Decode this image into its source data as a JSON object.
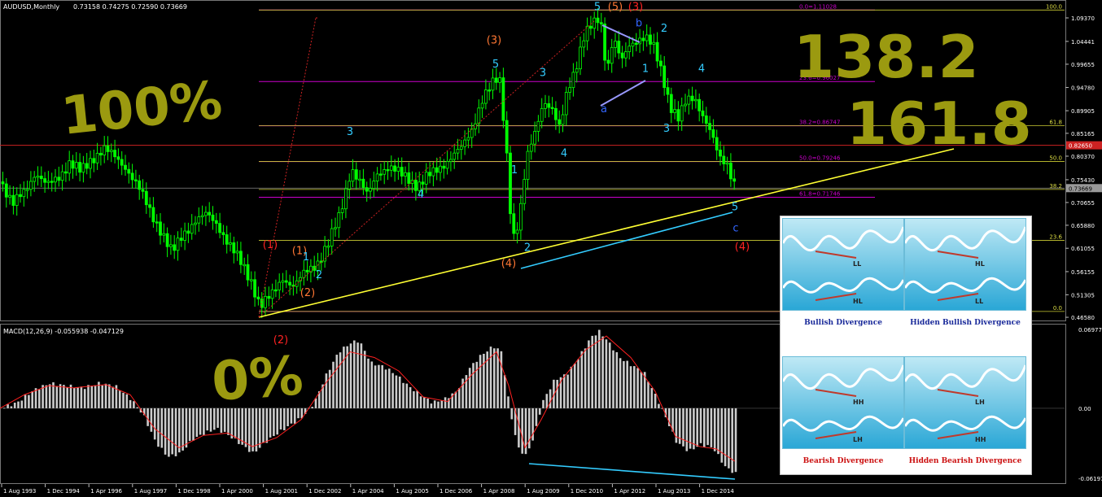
{
  "window": {
    "symbol_header": "AUDUSD,Monthly",
    "ohlc": "0.73158 0.74275 0.72590 0.73669",
    "macd_header": "MACD(12,26,9) -0.055938 -0.047129"
  },
  "colors": {
    "background": "#000000",
    "candle": "#00ff00",
    "fib": "#cc00cc",
    "trend": "#ffff33",
    "cyan": "#33ccff",
    "orange_label": "#ff7733",
    "red_label": "#ff2222",
    "blue_label": "#3366ff",
    "handwriting": "#9b9a10",
    "macd_hist": "#cccccc",
    "macd_signal": "#ff2020"
  },
  "annotations": {
    "big_100": "100%",
    "big_0": "0%",
    "big_138": "138.2",
    "big_161": "161.8"
  },
  "chart_data": [
    {
      "type": "candlestick",
      "title": "AUDUSD,Monthly",
      "ylim": [
        0.4659,
        1.1176
      ],
      "x_ticks": [
        "1 Aug 1993",
        "1 Dec 1994",
        "1 Apr 1996",
        "1 Aug 1997",
        "1 Dec 1998",
        "1 Apr 2000",
        "1 Aug 2001",
        "1 Dec 2002",
        "1 Apr 2004",
        "1 Aug 2005",
        "1 Dec 2006",
        "1 Apr 2008",
        "1 Aug 2009",
        "1 Dec 2010",
        "1 Apr 2012",
        "1 Aug 2013",
        "1 Dec 2014"
      ],
      "y_ticks": [
        "1.09370",
        "1.04441",
        "0.99655",
        "0.94780",
        "0.89905",
        "0.85165",
        "0.80370",
        "0.75430",
        "0.70655",
        "0.65880",
        "0.61055",
        "0.56155",
        "0.51305",
        "0.46580"
      ],
      "price_tags": [
        "0.82650",
        "0.73669"
      ],
      "price_path": [
        [
          0,
          0.75
        ],
        [
          14,
          0.7
        ],
        [
          28,
          0.73
        ],
        [
          42,
          0.77
        ],
        [
          56,
          0.74
        ],
        [
          70,
          0.76
        ],
        [
          84,
          0.79
        ],
        [
          98,
          0.77
        ],
        [
          112,
          0.8
        ],
        [
          126,
          0.82
        ],
        [
          140,
          0.8
        ],
        [
          154,
          0.78
        ],
        [
          168,
          0.74
        ],
        [
          182,
          0.69
        ],
        [
          196,
          0.65
        ],
        [
          210,
          0.6
        ],
        [
          224,
          0.64
        ],
        [
          238,
          0.67
        ],
        [
          252,
          0.68
        ],
        [
          266,
          0.66
        ],
        [
          280,
          0.62
        ],
        [
          294,
          0.58
        ],
        [
          308,
          0.54
        ],
        [
          318,
          0.49
        ],
        [
          332,
          0.51
        ],
        [
          346,
          0.55
        ],
        [
          360,
          0.53
        ],
        [
          374,
          0.56
        ],
        [
          388,
          0.58
        ],
        [
          402,
          0.62
        ],
        [
          416,
          0.68
        ],
        [
          430,
          0.78
        ],
        [
          440,
          0.75
        ],
        [
          450,
          0.72
        ],
        [
          462,
          0.77
        ],
        [
          474,
          0.78
        ],
        [
          486,
          0.77
        ],
        [
          500,
          0.76
        ],
        [
          512,
          0.74
        ],
        [
          524,
          0.76
        ],
        [
          538,
          0.78
        ],
        [
          552,
          0.8
        ],
        [
          566,
          0.82
        ],
        [
          578,
          0.86
        ],
        [
          590,
          0.92
        ],
        [
          602,
          0.95
        ],
        [
          612,
          0.97
        ],
        [
          620,
          0.84
        ],
        [
          628,
          0.63
        ],
        [
          636,
          0.66
        ],
        [
          646,
          0.8
        ],
        [
          656,
          0.86
        ],
        [
          666,
          0.92
        ],
        [
          676,
          0.9
        ],
        [
          686,
          0.86
        ],
        [
          696,
          0.95
        ],
        [
          706,
          0.99
        ],
        [
          716,
          1.05
        ],
        [
          726,
          1.08
        ],
        [
          736,
          1.1
        ],
        [
          744,
          0.98
        ],
        [
          752,
          1.05
        ],
        [
          762,
          1.0
        ],
        [
          772,
          1.04
        ],
        [
          782,
          1.05
        ],
        [
          792,
          1.05
        ],
        [
          802,
          1.03
        ],
        [
          812,
          0.98
        ],
        [
          822,
          0.91
        ],
        [
          832,
          0.88
        ],
        [
          842,
          0.92
        ],
        [
          852,
          0.93
        ],
        [
          862,
          0.89
        ],
        [
          872,
          0.85
        ],
        [
          882,
          0.8
        ],
        [
          892,
          0.79
        ],
        [
          900,
          0.75
        ],
        [
          904,
          0.74
        ]
      ],
      "fib_levels": [
        {
          "label": "0.0=1.11028",
          "value": 1.11028
        },
        {
          "label": "23.6=0.96027",
          "value": 0.96027
        },
        {
          "label": "38.2=0.86747",
          "value": 0.86747
        },
        {
          "label": "50.0=0.79246",
          "value": 0.79246
        },
        {
          "label": "61.8=0.71746",
          "value": 0.71746
        }
      ],
      "ext_levels": [
        {
          "label": "100.0",
          "value": 1.11028
        },
        {
          "label": "61.8",
          "value": 0.86747
        },
        {
          "label": "50.0",
          "value": 0.79246
        },
        {
          "label": "38.2",
          "value": 0.734
        },
        {
          "label": "23.6",
          "value": 0.627
        },
        {
          "label": "0.0",
          "value": 0.478
        }
      ],
      "wave_labels": [
        {
          "text": "(1)",
          "x": 332,
          "y": 0.611,
          "color": "red_label"
        },
        {
          "text": "(1)",
          "x": 368,
          "y": 0.598,
          "color": "orange_label"
        },
        {
          "text": "1",
          "x": 376,
          "y": 0.585,
          "color": "cyan"
        },
        {
          "text": "2",
          "x": 392,
          "y": 0.548,
          "color": "cyan"
        },
        {
          "text": "(2)",
          "x": 378,
          "y": 0.51,
          "color": "orange_label"
        },
        {
          "text": "3",
          "x": 430,
          "y": 0.848,
          "color": "cyan"
        },
        {
          "text": "4",
          "x": 517,
          "y": 0.717,
          "color": "cyan"
        },
        {
          "text": "(3)",
          "x": 607,
          "y": 1.04,
          "color": "orange_label"
        },
        {
          "text": "5",
          "x": 609,
          "y": 0.99,
          "color": "cyan"
        },
        {
          "text": "3",
          "x": 667,
          "y": 0.972,
          "color": "cyan"
        },
        {
          "text": "1",
          "x": 632,
          "y": 0.768,
          "color": "cyan"
        },
        {
          "text": "4",
          "x": 693,
          "y": 0.803,
          "color": "cyan"
        },
        {
          "text": "2",
          "x": 648,
          "y": 0.605,
          "color": "cyan"
        },
        {
          "text": "(4)",
          "x": 625,
          "y": 0.572,
          "color": "orange_label"
        },
        {
          "text": "5",
          "x": 734,
          "y": 1.11,
          "color": "cyan"
        },
        {
          "text": "(5)",
          "x": 756,
          "y": 1.11,
          "color": "orange_label"
        },
        {
          "text": "(3)",
          "x": 781,
          "y": 1.11,
          "color": "red_label"
        },
        {
          "text": "b",
          "x": 785,
          "y": 1.076,
          "color": "blue_label"
        },
        {
          "text": "2",
          "x": 816,
          "y": 1.065,
          "color": "cyan"
        },
        {
          "text": "1",
          "x": 793,
          "y": 0.98,
          "color": "cyan"
        },
        {
          "text": "a",
          "x": 742,
          "y": 0.896,
          "color": "blue_label"
        },
        {
          "text": "4",
          "x": 862,
          "y": 0.98,
          "color": "cyan"
        },
        {
          "text": "3",
          "x": 819,
          "y": 0.855,
          "color": "cyan"
        },
        {
          "text": "5",
          "x": 903,
          "y": 0.69,
          "color": "cyan"
        },
        {
          "text": "c",
          "x": 904,
          "y": 0.646,
          "color": "blue_label"
        },
        {
          "text": "(4)",
          "x": 912,
          "y": 0.607,
          "color": "red_label"
        }
      ]
    },
    {
      "type": "bar",
      "title": "MACD(12,26,9) -0.055938 -0.047129",
      "ylim": [
        -0.0635,
        0.072
      ],
      "y_ticks": [
        "0.06977",
        "0.00",
        "-0.06197"
      ],
      "hist_path": [
        [
          0,
          0
        ],
        [
          20,
          0.005
        ],
        [
          40,
          0.016
        ],
        [
          60,
          0.022
        ],
        [
          80,
          0.02
        ],
        [
          100,
          0.018
        ],
        [
          120,
          0.022
        ],
        [
          140,
          0.02
        ],
        [
          160,
          0.008
        ],
        [
          175,
          -0.006
        ],
        [
          190,
          -0.03
        ],
        [
          205,
          -0.043
        ],
        [
          220,
          -0.04
        ],
        [
          235,
          -0.028
        ],
        [
          250,
          -0.022
        ],
        [
          265,
          -0.018
        ],
        [
          280,
          -0.024
        ],
        [
          295,
          -0.032
        ],
        [
          310,
          -0.04
        ],
        [
          325,
          -0.03
        ],
        [
          340,
          -0.022
        ],
        [
          355,
          -0.015
        ],
        [
          370,
          -0.008
        ],
        [
          385,
          0.005
        ],
        [
          400,
          0.03
        ],
        [
          415,
          0.05
        ],
        [
          430,
          0.058
        ],
        [
          440,
          0.06
        ],
        [
          455,
          0.04
        ],
        [
          470,
          0.037
        ],
        [
          485,
          0.03
        ],
        [
          500,
          0.02
        ],
        [
          515,
          0.012
        ],
        [
          530,
          0.005
        ],
        [
          545,
          0.008
        ],
        [
          560,
          0.015
        ],
        [
          575,
          0.035
        ],
        [
          590,
          0.047
        ],
        [
          605,
          0.055
        ],
        [
          615,
          0.05
        ],
        [
          625,
          0.0
        ],
        [
          635,
          -0.035
        ],
        [
          645,
          -0.042
        ],
        [
          655,
          -0.025
        ],
        [
          665,
          0.005
        ],
        [
          680,
          0.025
        ],
        [
          695,
          0.03
        ],
        [
          710,
          0.045
        ],
        [
          725,
          0.063
        ],
        [
          735,
          0.068
        ],
        [
          745,
          0.06
        ],
        [
          760,
          0.045
        ],
        [
          775,
          0.038
        ],
        [
          790,
          0.032
        ],
        [
          805,
          0.01
        ],
        [
          815,
          -0.005
        ],
        [
          830,
          -0.03
        ],
        [
          845,
          -0.038
        ],
        [
          860,
          -0.032
        ],
        [
          875,
          -0.035
        ],
        [
          890,
          -0.052
        ],
        [
          903,
          -0.058
        ]
      ],
      "signal_path": [
        [
          0,
          0
        ],
        [
          30,
          0.012
        ],
        [
          60,
          0.02
        ],
        [
          90,
          0.018
        ],
        [
          130,
          0.021
        ],
        [
          160,
          0.012
        ],
        [
          190,
          -0.018
        ],
        [
          220,
          -0.035
        ],
        [
          250,
          -0.024
        ],
        [
          280,
          -0.022
        ],
        [
          310,
          -0.034
        ],
        [
          340,
          -0.026
        ],
        [
          370,
          -0.01
        ],
        [
          400,
          0.022
        ],
        [
          430,
          0.05
        ],
        [
          460,
          0.045
        ],
        [
          490,
          0.033
        ],
        [
          520,
          0.01
        ],
        [
          550,
          0.006
        ],
        [
          580,
          0.03
        ],
        [
          610,
          0.05
        ],
        [
          625,
          0.02
        ],
        [
          645,
          -0.035
        ],
        [
          665,
          -0.01
        ],
        [
          690,
          0.025
        ],
        [
          720,
          0.052
        ],
        [
          745,
          0.064
        ],
        [
          775,
          0.045
        ],
        [
          805,
          0.015
        ],
        [
          830,
          -0.025
        ],
        [
          860,
          -0.034
        ],
        [
          880,
          -0.036
        ],
        [
          903,
          -0.047
        ]
      ]
    }
  ],
  "divergence_cards": [
    {
      "caption": "Bullish Divergence",
      "hl_top": "LL",
      "hl_bottom": "HL",
      "caption_color": "#1a2a9a"
    },
    {
      "caption": "Hidden Bullish Divergence",
      "hl_top": "HL",
      "hl_bottom": "LL",
      "caption_color": "#1a2a9a"
    },
    {
      "caption": "Bearish Divergence",
      "hl_top": "HH",
      "hl_bottom": "LH",
      "caption_color": "#cc1111"
    },
    {
      "caption": "Hidden Bearish Divergence",
      "hl_top": "LH",
      "hl_bottom": "HH",
      "caption_color": "#cc1111"
    }
  ]
}
